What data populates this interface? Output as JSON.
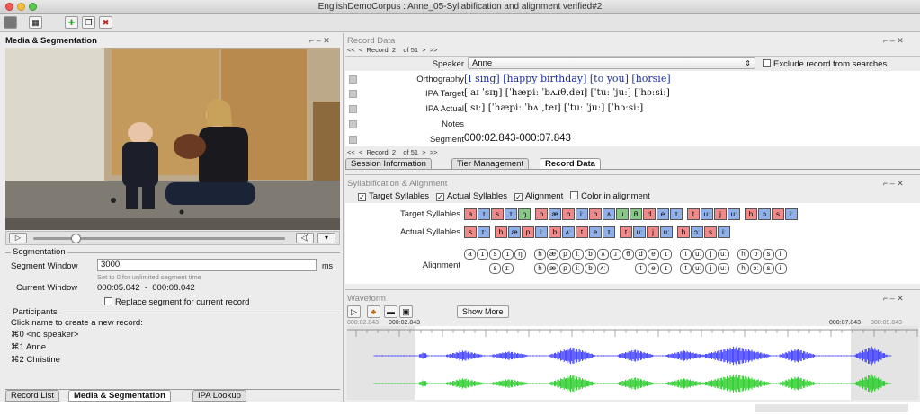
{
  "window": {
    "title": "EnglishDemoCorpus : Anne_05-Syllabification and alignment verified#2"
  },
  "media_panel": {
    "title": "Media & Segmentation",
    "segmentation_label": "Segmentation",
    "segment_window_label": "Segment Window",
    "segment_window_value": "3000",
    "segment_window_unit": "ms",
    "segment_window_hint": "Set to 0 for unlimited segment time",
    "current_window_label": "Current Window",
    "current_window_value": "000:05.042  -  000:08.042",
    "replace_label": "Replace segment for current record",
    "participants_label": "Participants",
    "participants_hint": "Click name to create a new record:",
    "participants": [
      "⌘0 <no speaker>",
      "⌘1 Anne",
      "⌘2 Christine"
    ],
    "bottom_tabs": [
      "Record List",
      "Media & Segmentation",
      "IPA Lookup"
    ],
    "slider_fraction": 0.15
  },
  "record_panel": {
    "title": "Record Data",
    "nav_top": {
      "prev2": "<<",
      "prev": "<",
      "label": "Record:",
      "value": "2",
      "of": "of 51",
      "next": ">",
      "next2": ">>"
    },
    "speaker_label": "Speaker",
    "speaker_value": "Anne",
    "exclude_label": "Exclude record from searches",
    "orthography_label": "Orthography",
    "orthography_value": "[I sing] [happy birthday] [to you] [horsie]",
    "ipa_target_label": "IPA Target",
    "ipa_target_value": "[ˈaɪ ˈsɪŋ] [ˈhæpiː ˈbʌɹθ,deɪ] [ˈtuː ˈjuː] [ˈhɔːsiː]",
    "ipa_actual_label": "IPA Actual",
    "ipa_actual_value": "[ˈsɪː] [ˈhæpiː ˈbʌː,teɪ] [ˈtuː ˈjuː] [ˈhɔːsiː]",
    "notes_label": "Notes",
    "segment_label": "Segment",
    "segment_value": "000:02.843-000:07.843",
    "tabs": [
      "Session Information",
      "Tier Management",
      "Record Data"
    ]
  },
  "syll_panel": {
    "title": "Syllabification & Alignment",
    "checks": [
      {
        "label": "Target Syllables",
        "checked": true
      },
      {
        "label": "Actual Syllables",
        "checked": true
      },
      {
        "label": "Alignment",
        "checked": true
      },
      {
        "label": "Color in alignment",
        "checked": false
      }
    ],
    "target_label": "Target Syllables",
    "actual_label": "Actual Syllables",
    "alignment_label": "Alignment",
    "target_syllables": [
      {
        "t": "a",
        "c": "pink"
      },
      {
        "t": "ɪ",
        "c": "blue"
      },
      {
        "t": "s",
        "c": "pink"
      },
      {
        "t": "ɪ",
        "c": "blue"
      },
      {
        "t": "ŋ",
        "c": "green"
      },
      {
        "t": "h",
        "c": "pink"
      },
      {
        "t": "æ",
        "c": "blue"
      },
      {
        "t": "p",
        "c": "pink"
      },
      {
        "t": "iː",
        "c": "blue"
      },
      {
        "t": "b",
        "c": "pink"
      },
      {
        "t": "ʌ",
        "c": "blue"
      },
      {
        "t": "ɹ",
        "c": "green"
      },
      {
        "t": "θ",
        "c": "green"
      },
      {
        "t": "d",
        "c": "pink"
      },
      {
        "t": "e",
        "c": "blue"
      },
      {
        "t": "ɪ",
        "c": "blue"
      },
      {
        "t": "t",
        "c": "pink"
      },
      {
        "t": "uː",
        "c": "blue"
      },
      {
        "t": "j",
        "c": "pink"
      },
      {
        "t": "uː",
        "c": "blue"
      },
      {
        "t": "h",
        "c": "pink"
      },
      {
        "t": "ɔ",
        "c": "blue"
      },
      {
        "t": "s",
        "c": "pink"
      },
      {
        "t": "iː",
        "c": "blue"
      }
    ],
    "actual_syllables": [
      {
        "t": "s",
        "c": "pink"
      },
      {
        "t": "ɪː",
        "c": "blue"
      },
      {
        "t": "h",
        "c": "pink"
      },
      {
        "t": "æ",
        "c": "blue"
      },
      {
        "t": "p",
        "c": "pink"
      },
      {
        "t": "iː",
        "c": "blue"
      },
      {
        "t": "b",
        "c": "pink"
      },
      {
        "t": "ʌː",
        "c": "blue"
      },
      {
        "t": "t",
        "c": "pink"
      },
      {
        "t": "e",
        "c": "blue"
      },
      {
        "t": "ɪ",
        "c": "blue"
      },
      {
        "t": "t",
        "c": "pink"
      },
      {
        "t": "uː",
        "c": "blue"
      },
      {
        "t": "j",
        "c": "pink"
      },
      {
        "t": "uː",
        "c": "blue"
      },
      {
        "t": "h",
        "c": "pink"
      },
      {
        "t": "ɔː",
        "c": "blue"
      },
      {
        "t": "s",
        "c": "pink"
      },
      {
        "t": "iː",
        "c": "blue"
      }
    ],
    "alignment_top": [
      "a",
      "ɪ",
      "s",
      "ɪ",
      "ŋ",
      "h",
      "æ",
      "p",
      "iː",
      "b",
      "ʌ",
      "ɹ",
      "θ",
      "d",
      "e",
      "ɪ",
      "t",
      "uː",
      "j",
      "uː",
      "h",
      "ɔ",
      "s",
      "iː"
    ],
    "alignment_bottom": [
      "",
      "",
      "s",
      "ɪː",
      "",
      "h",
      "æ",
      "p",
      "iː",
      "b",
      "ʌː",
      "",
      "",
      "t",
      "e",
      "ɪ",
      "t",
      "uː",
      "j",
      "uː",
      "h",
      "ɔː",
      "s",
      "iː"
    ]
  },
  "waveform_panel": {
    "title": "Waveform",
    "show_more": "Show More",
    "time_left": "000:02.843",
    "time_left2": "000:02.843",
    "time_right": "000:07.843",
    "time_right2": "000:09.843",
    "colors": {
      "top_channel": "#3a3aff",
      "bottom_channel": "#22cc22"
    }
  },
  "panel_controls": "⌐ – ✕"
}
